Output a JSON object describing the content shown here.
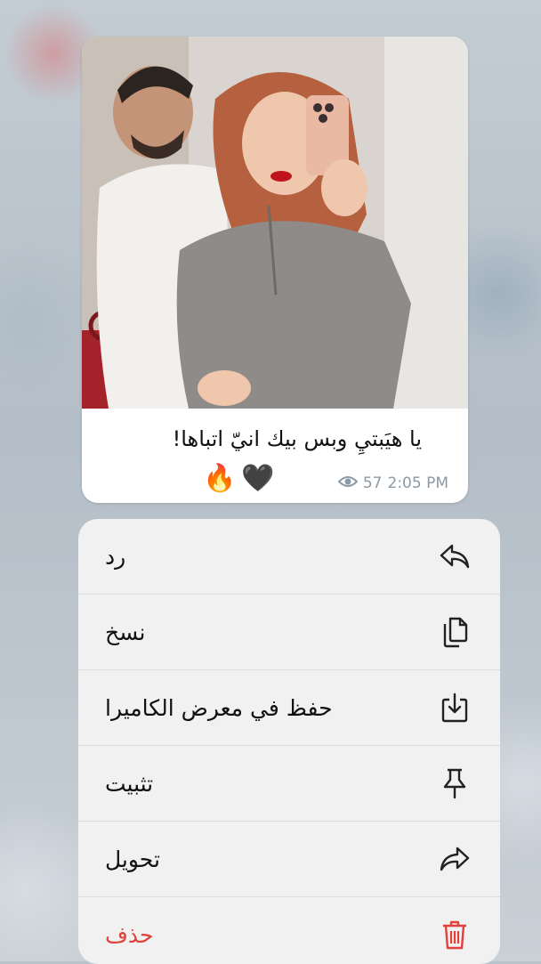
{
  "message": {
    "caption": "يا هيَبتيِ وبس بيك انيّ اتباها!",
    "emojis": [
      "🔥",
      "🖤"
    ],
    "views": "57",
    "time": "2:05 PM"
  },
  "context_menu": {
    "items": [
      {
        "label": "رد",
        "icon": "reply-icon"
      },
      {
        "label": "نسخ",
        "icon": "copy-icon"
      },
      {
        "label": "حفظ في معرض الكاميرا",
        "icon": "save-to-gallery-icon"
      },
      {
        "label": "تثبيت",
        "icon": "pin-icon"
      },
      {
        "label": "تحويل",
        "icon": "forward-icon"
      },
      {
        "label": "حذف",
        "icon": "trash-icon"
      }
    ]
  },
  "colors": {
    "danger": "#e0413a",
    "meta": "#8a9aa6",
    "menu_bg": "#f1f1f1"
  }
}
